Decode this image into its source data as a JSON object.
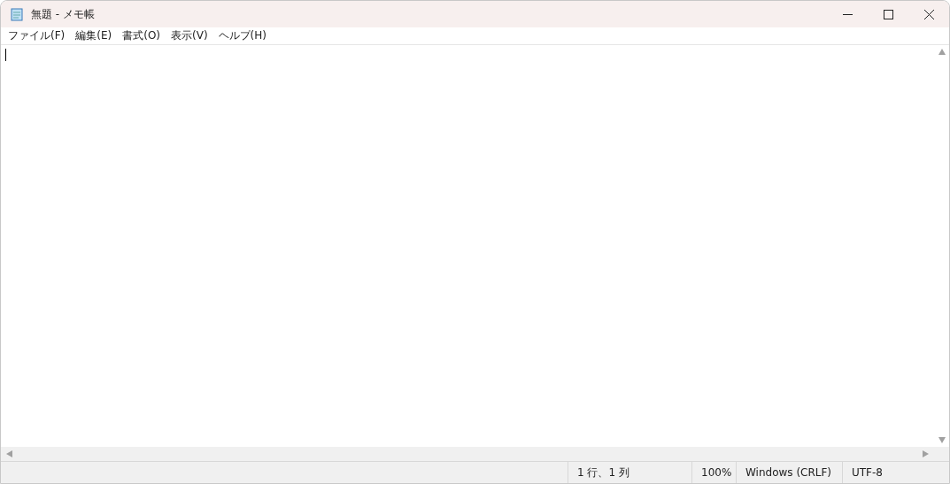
{
  "window": {
    "title": "無題 - メモ帳"
  },
  "menu": [
    "ファイル(F)",
    "編集(E)",
    "書式(O)",
    "表示(V)",
    "ヘルプ(H)"
  ],
  "status_bar": [
    "1 行、1 列",
    "100%",
    "Windows (CRLF)",
    "UTF-8"
  ]
}
